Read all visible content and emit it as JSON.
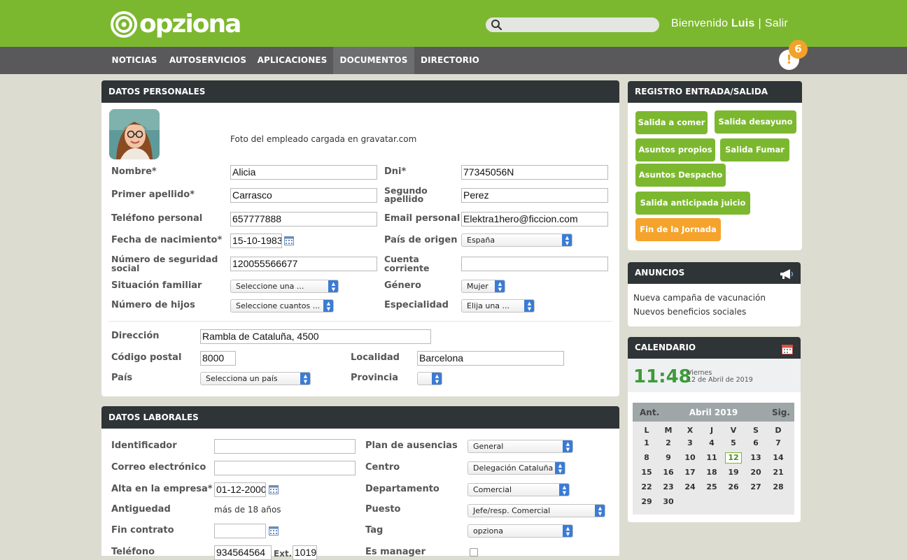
{
  "header": {
    "logo_text": "opziona",
    "search_placeholder": "",
    "welcome": "Bienvenido",
    "user": "Luis",
    "separator": "|",
    "logout": "Salir",
    "notification_symbol": "!",
    "notification_count": "6",
    "brand_color": "#7cb82f",
    "alert_color": "#f2a22b"
  },
  "nav": {
    "items": [
      "NOTICIAS",
      "AUTOSERVICIOS",
      "APLICACIONES",
      "DOCUMENTOS",
      "DIRECTORIO"
    ],
    "active": "DOCUMENTOS"
  },
  "personal": {
    "title": "DATOS PERSONALES",
    "photo_caption": "Foto del empleado cargada en gravatar.com",
    "nombre_label": "Nombre*",
    "nombre": "Alicia",
    "dni_label": "Dni*",
    "dni": "77345056N",
    "apellido1_label": "Primer apellido*",
    "apellido1": "Carrasco",
    "apellido2_label_1": "Segundo",
    "apellido2_label_2": "apellido",
    "apellido2": "Perez",
    "telefono_label": "Teléfono personal",
    "telefono": "657777888",
    "email_label": "Email personal",
    "email": "Elektra1hero@ficcion.com",
    "nacimiento_label": "Fecha de nacimiento*",
    "nacimiento": "15-10-1983",
    "pais_origen_label": "País de origen",
    "pais_origen": "España",
    "nss_label_1": "Número de seguridad",
    "nss_label_2": "social",
    "nss": "120055566677",
    "cuenta_label_1": "Cuenta",
    "cuenta_label_2": "corriente",
    "cuenta": "",
    "situacion_label": "Situación familiar",
    "situacion": "Seleccione una ...",
    "genero_label": "Género",
    "genero": "Mujer",
    "hijos_label": "Número de hijos",
    "hijos": "Seleccione cuantos ...",
    "especialidad_label": "Especialidad",
    "especialidad": "Elija una ...",
    "direccion_label": "Dirección",
    "direccion": "Rambla de Cataluña, 4500",
    "cp_label": "Código postal",
    "cp": "8000",
    "localidad_label": "Localidad",
    "localidad": "Barcelona",
    "pais_label": "País",
    "pais": "Selecciona un país",
    "provincia_label": "Provincia",
    "provincia": ""
  },
  "laboral": {
    "title": "DATOS LABORALES",
    "identificador_label": "Identificador",
    "identificador": "",
    "plan_label": "Plan de ausencias",
    "plan": "General",
    "correo_label": "Correo electrónico",
    "correo": "",
    "centro_label": "Centro",
    "centro": "Delegación Cataluña",
    "alta_label": "Alta en la empresa*",
    "alta": "01-12-2000",
    "departamento_label": "Departamento",
    "departamento": "Comercial",
    "antiguedad_label": "Antiguedad",
    "antiguedad": "más de 18 años",
    "puesto_label": "Puesto",
    "puesto": "Jefe/resp. Comercial",
    "fin_label": "Fin contrato",
    "fin": "",
    "tag_label": "Tag",
    "tag": "opziona",
    "telefono_label": "Teléfono",
    "telefono": "934564564",
    "ext_label": "Ext.",
    "ext": "1019",
    "manager_label": "Es manager"
  },
  "registro": {
    "title": "REGISTRO ENTRADA/SALIDA",
    "buttons": [
      "Salida a comer",
      "Salida desayuno",
      "Asuntos propios",
      "Salida Fumar",
      "Asuntos Despacho",
      "Salida anticipada juicio",
      "Fin de la Jornada"
    ]
  },
  "anuncios": {
    "title": "ANUNCIOS",
    "items": [
      "Nueva campaña de vacunación",
      "Nuevos beneficios sociales"
    ]
  },
  "calendario": {
    "title": "CALENDARIO",
    "time": "11:48",
    "weekday": "Viernes",
    "date": "12 de Abril de 2019",
    "prev": "Ant.",
    "month": "Abril 2019",
    "next": "Sig.",
    "weekdays": [
      "L",
      "M",
      "X",
      "J",
      "V",
      "S",
      "D"
    ],
    "weeks": [
      [
        "1",
        "2",
        "3",
        "4",
        "5",
        "6",
        "7"
      ],
      [
        "8",
        "9",
        "10",
        "11",
        "12",
        "13",
        "14"
      ],
      [
        "15",
        "16",
        "17",
        "18",
        "19",
        "20",
        "21"
      ],
      [
        "22",
        "23",
        "24",
        "25",
        "26",
        "27",
        "28"
      ],
      [
        "29",
        "30",
        "",
        "",
        "",
        "",
        ""
      ]
    ],
    "today": "12"
  }
}
